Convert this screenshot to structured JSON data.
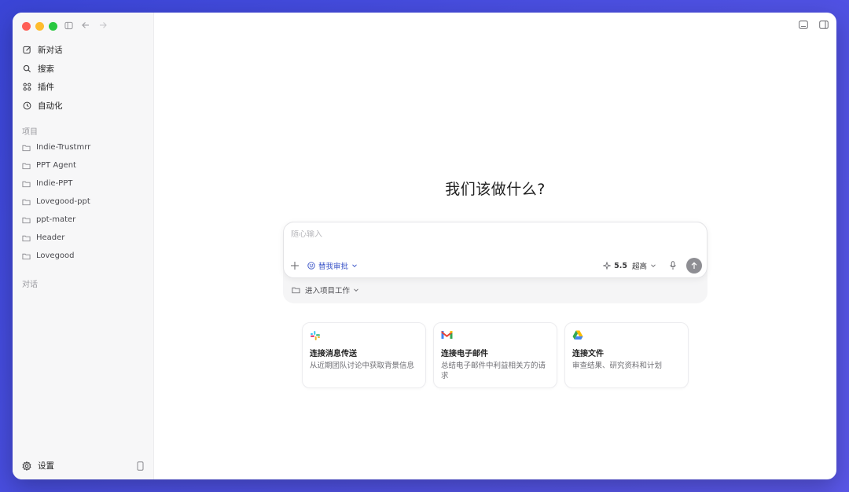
{
  "sidebar": {
    "nav": [
      {
        "label": "新对话",
        "icon": "edit-icon"
      },
      {
        "label": "搜索",
        "icon": "search-icon"
      },
      {
        "label": "插件",
        "icon": "plugins-icon"
      },
      {
        "label": "自动化",
        "icon": "clock-icon"
      }
    ],
    "projects_label": "项目",
    "projects": [
      "Indie-Trustmrr",
      "PPT Agent",
      "Indie-PPT",
      "Lovegood-ppt",
      "ppt-mater",
      "Header",
      "Lovegood"
    ],
    "chats_label": "对话",
    "settings_label": "设置"
  },
  "main": {
    "heading": "我们该做什么?",
    "composer": {
      "placeholder": "随心输入",
      "approve_label": "替我审批",
      "model_version": "5.5",
      "model_mode": "超高"
    },
    "project_select_label": "进入项目工作",
    "cards": [
      {
        "title": "连接消息传送",
        "desc": "从近期团队讨论中获取背景信息",
        "icon": "slack-icon"
      },
      {
        "title": "连接电子邮件",
        "desc": "总结电子邮件中利益相关方的请求",
        "icon": "gmail-icon"
      },
      {
        "title": "连接文件",
        "desc": "审查结果、研究资料和计划",
        "icon": "google-drive-icon"
      }
    ]
  },
  "colors": {
    "background": "#4b4fe0",
    "accent": "#3b55c8",
    "send_button": "#8e8e93"
  }
}
